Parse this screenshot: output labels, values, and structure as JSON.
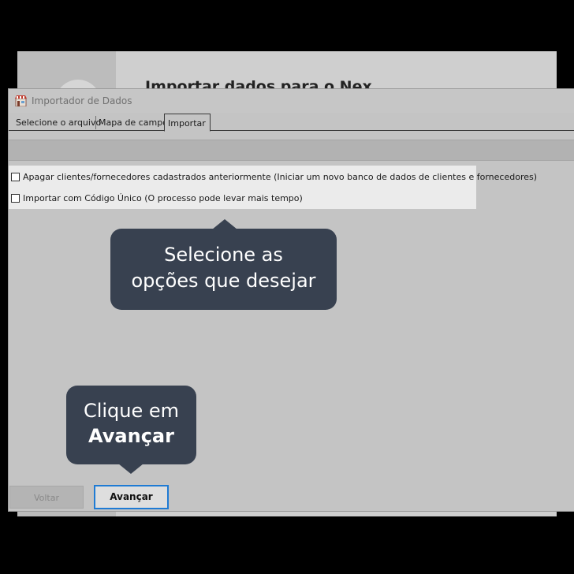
{
  "background_window": {
    "title": "Importar dados para o Nex"
  },
  "dialog": {
    "title": "Importador de Dados",
    "icon": "store-icon",
    "tabs": [
      {
        "label": "Selecione o arquivo"
      },
      {
        "label": "Mapa de campos"
      },
      {
        "label": "Importar",
        "active": true
      }
    ],
    "options": [
      {
        "label": "Apagar clientes/fornecedores cadastrados anteriormente (Iniciar um novo banco de dados de clientes e fornecedores)",
        "checked": false
      },
      {
        "label": "Importar com Código Único (O processo pode levar mais tempo)",
        "checked": false
      }
    ],
    "buttons": {
      "back": "Voltar",
      "next": "Avançar"
    }
  },
  "tooltips": {
    "options_line1": "Selecione as",
    "options_line2": "opções que desejar",
    "next_line1": "Clique em",
    "next_line2": "Avançar"
  },
  "colors": {
    "tooltip_bg": "#384150",
    "focus_border": "#1f7bd4"
  }
}
